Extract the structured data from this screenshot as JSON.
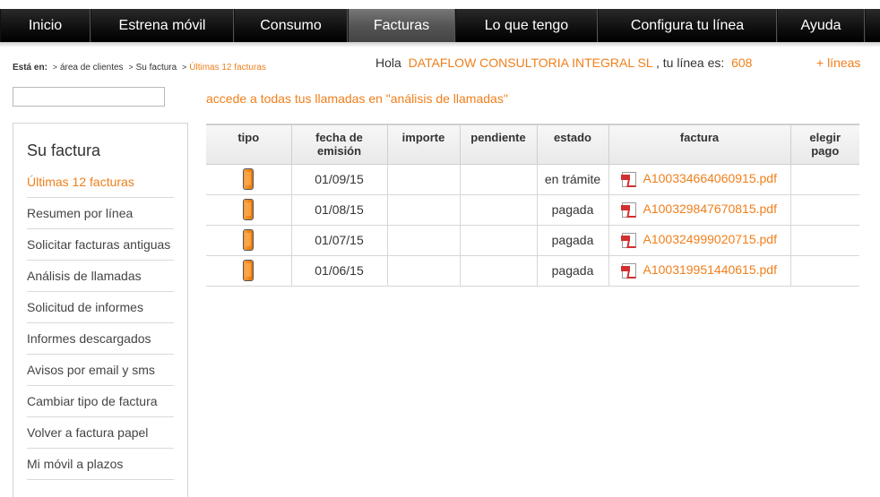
{
  "nav": {
    "items": [
      {
        "label": "Inicio",
        "active": false
      },
      {
        "label": "Estrena móvil",
        "active": false
      },
      {
        "label": "Consumo",
        "active": false
      },
      {
        "label": "Facturas",
        "active": true
      },
      {
        "label": "Lo que tengo",
        "active": false
      },
      {
        "label": "Configura tu línea",
        "active": false
      },
      {
        "label": "Ayuda",
        "active": false
      }
    ]
  },
  "breadcrumb": {
    "prefix": "Está en:",
    "items": [
      "área de clientes",
      "Su factura",
      "Últimas 12 facturas"
    ]
  },
  "greeting": {
    "hello": "Hola",
    "org": "DATAFLOW CONSULTORIA INTEGRAL SL",
    "line_text": ", tu línea es:",
    "line": "608",
    "more_lines": "+ líneas"
  },
  "search": {
    "value": ""
  },
  "sidebar": {
    "title": "Su factura",
    "items": [
      {
        "label": "Últimas 12 facturas",
        "active": true
      },
      {
        "label": "Resumen por línea",
        "active": false
      },
      {
        "label": "Solicitar facturas antiguas",
        "active": false
      },
      {
        "label": "Análisis de llamadas",
        "active": false
      },
      {
        "label": "Solicitud de informes",
        "active": false
      },
      {
        "label": "Informes descargados",
        "active": false
      },
      {
        "label": "Avisos por email y sms",
        "active": false
      },
      {
        "label": "Cambiar tipo de factura",
        "active": false
      },
      {
        "label": "Volver a factura papel",
        "active": false
      },
      {
        "label": "Mi móvil a plazos",
        "active": false
      }
    ]
  },
  "info_link": "accede a todas tus llamadas en \"análisis de llamadas\"",
  "table": {
    "headers": {
      "tipo": "tipo",
      "fecha_1": "fecha de",
      "fecha_2": "emisión",
      "importe": "importe",
      "pendiente": "pendiente",
      "estado": "estado",
      "factura": "factura",
      "pago_1": "elegir",
      "pago_2": "pago"
    },
    "rows": [
      {
        "tipo": "mobile-phone-icon",
        "fecha": "01/09/15",
        "importe": "",
        "pendiente": "",
        "estado": "en trámite",
        "factura": "A100334664060915.pdf"
      },
      {
        "tipo": "mobile-phone-icon",
        "fecha": "01/08/15",
        "importe": "",
        "pendiente": "",
        "estado": "pagada",
        "factura": "A100329847670815.pdf"
      },
      {
        "tipo": "mobile-phone-icon",
        "fecha": "01/07/15",
        "importe": "",
        "pendiente": "",
        "estado": "pagada",
        "factura": "A100324999020715.pdf"
      },
      {
        "tipo": "mobile-phone-icon",
        "fecha": "01/06/15",
        "importe": "",
        "pendiente": "",
        "estado": "pagada",
        "factura": "A100319951440615.pdf"
      }
    ]
  },
  "colors": {
    "accent": "#f07f1b",
    "nav_bg": "#111111",
    "nav_active": "#555555"
  }
}
